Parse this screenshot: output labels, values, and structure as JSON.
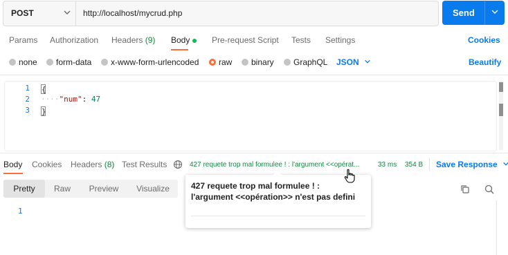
{
  "request": {
    "method": "POST",
    "url": "http://localhost/mycrud.php",
    "send_label": "Send"
  },
  "request_tabs": [
    {
      "label": "Params"
    },
    {
      "label": "Authorization"
    },
    {
      "label": "Headers",
      "count": "(9)"
    },
    {
      "label": "Body"
    },
    {
      "label": "Pre-request Script"
    },
    {
      "label": "Tests"
    },
    {
      "label": "Settings"
    }
  ],
  "cookies_label": "Cookies",
  "body_types": [
    {
      "label": "none"
    },
    {
      "label": "form-data"
    },
    {
      "label": "x-www-form-urlencoded"
    },
    {
      "label": "raw"
    },
    {
      "label": "binary"
    },
    {
      "label": "GraphQL"
    }
  ],
  "raw_format": "JSON",
  "beautify_label": "Beautify",
  "editor": {
    "line_numbers": [
      "1",
      "2",
      "3"
    ],
    "line1": "{",
    "indent_dots": "····",
    "key": "\"num\"",
    "colon": ": ",
    "value": "47",
    "line3": "}"
  },
  "response_tabs": [
    {
      "label": "Body"
    },
    {
      "label": "Cookies"
    },
    {
      "label": "Headers",
      "count": "(8)"
    },
    {
      "label": "Test Results"
    }
  ],
  "response_status": {
    "status_text": "427 requete trop mal formulee ! : l'argument <<opérat...",
    "time": "33 ms",
    "size": "354 B"
  },
  "save_response_label": "Save Response",
  "view_tabs": [
    {
      "label": "Pretty"
    },
    {
      "label": "Raw"
    },
    {
      "label": "Preview"
    },
    {
      "label": "Visualize"
    }
  ],
  "response_body": {
    "line_numbers": [
      "1"
    ]
  },
  "tooltip": {
    "text": "427 requete trop mal formulee ! : l'argument <<opération>> n'est pas defini"
  },
  "colors": {
    "accent": "#097bed",
    "active_tab": "#ff6c37",
    "success": "#0c8a3c"
  }
}
